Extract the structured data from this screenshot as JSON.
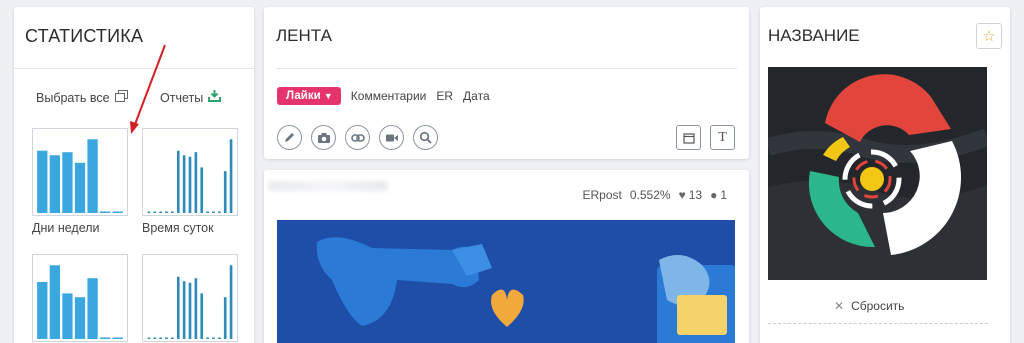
{
  "stats": {
    "title": "СТАТИСТИКА",
    "select_all": "Выбрать все",
    "reports": "Отчеты",
    "charts": [
      {
        "label": "Дни недели",
        "values": [
          0.82,
          0.76,
          0.8,
          0.66,
          0.97,
          0.02,
          0.02
        ],
        "color": "#3aa8df"
      },
      {
        "label": "Время суток",
        "values": [
          0.02,
          0.02,
          0.02,
          0.02,
          0.02,
          0.82,
          0.76,
          0.74,
          0.8,
          0.6,
          0.02,
          0.02,
          0.02,
          0.55,
          0.97
        ],
        "color": "#2e8ab8"
      },
      {
        "label": "",
        "values": [
          0.75,
          0.97,
          0.6,
          0.55,
          0.8,
          0.02,
          0.02
        ],
        "color": "#3aa8df"
      },
      {
        "label": "",
        "values": [
          0.02,
          0.02,
          0.02,
          0.02,
          0.02,
          0.82,
          0.76,
          0.74,
          0.8,
          0.6,
          0.02,
          0.02,
          0.02,
          0.55,
          0.97
        ],
        "color": "#2e8ab8"
      }
    ]
  },
  "feed": {
    "title": "ЛЕНТА",
    "sort_active": "Лайки",
    "sort_items": [
      "Комментарии",
      "ER",
      "Дата"
    ],
    "tools": [
      "pencil-icon",
      "camera-icon",
      "link-icon",
      "video-icon",
      "search-icon"
    ],
    "calendar_icon": "calendar-icon",
    "text_button": "T"
  },
  "post": {
    "erpost_label": "ERpost",
    "erpost_value": "0.552%",
    "likes": "13",
    "comments": "1"
  },
  "name_panel": {
    "title": "НАЗВАНИЕ",
    "reset": "Сбросить"
  },
  "colors": {
    "accent": "#e5336b",
    "bar": "#3aa8df",
    "star": "#e5a83a"
  }
}
